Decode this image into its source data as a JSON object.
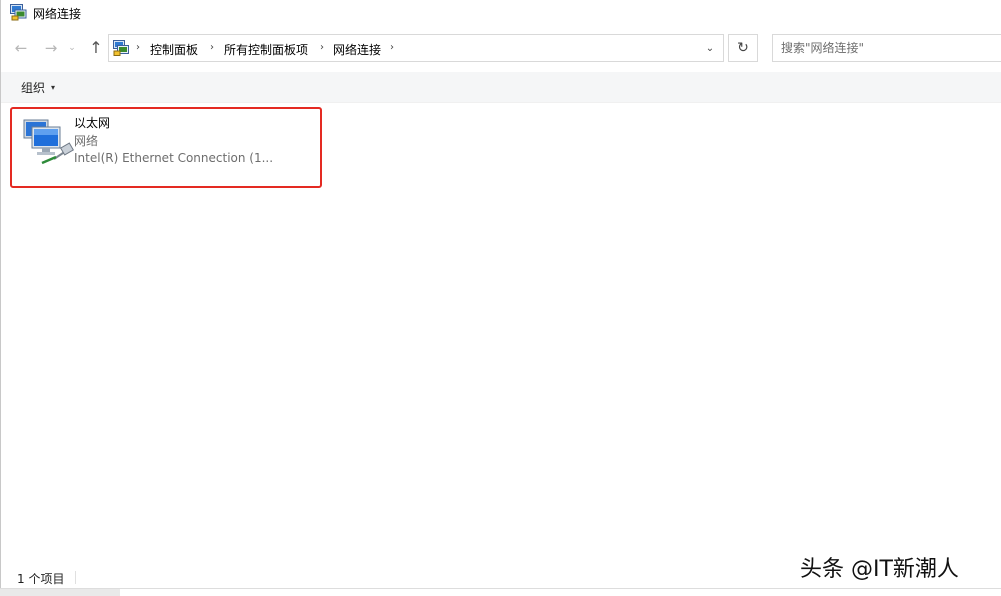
{
  "window": {
    "title": "网络连接"
  },
  "nav": {
    "back_glyph": "←",
    "forward_glyph": "→",
    "recent_glyph": "⌄",
    "up_glyph": "↑",
    "breadcrumbs": [
      "控制面板",
      "所有控制面板项",
      "网络连接"
    ],
    "separator_glyph": "›",
    "dropdown_glyph": "⌄",
    "refresh_glyph": "↻"
  },
  "search": {
    "placeholder": "搜索\"网络连接\""
  },
  "toolbar": {
    "organize_label": "组织",
    "organize_caret": "▾"
  },
  "items": [
    {
      "name": "以太网",
      "type": "网络",
      "device": "Intel(R) Ethernet Connection (1..."
    }
  ],
  "status": {
    "count_text": "1 个项目"
  },
  "watermark": {
    "text": "头条 @IT新潮人"
  },
  "colors": {
    "highlight_border": "#e42a22",
    "command_bar_bg": "#f5f6f7"
  }
}
